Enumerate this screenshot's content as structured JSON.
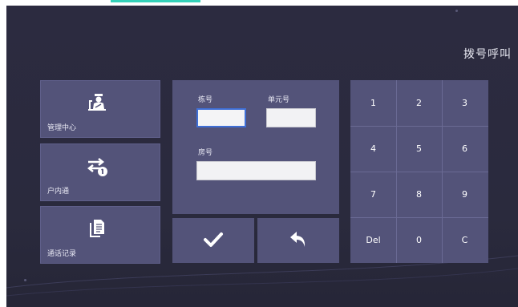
{
  "title": "拨号呼叫",
  "menu": [
    {
      "label": "管理中心",
      "icon": "guard-icon"
    },
    {
      "label": "户内通",
      "icon": "intercom-icon"
    },
    {
      "label": "通话记录",
      "icon": "records-icon"
    }
  ],
  "form": {
    "building_label": "栋号",
    "building_value": "",
    "unit_label": "单元号",
    "unit_value": "",
    "room_label": "房号",
    "room_value": ""
  },
  "actions": {
    "confirm_icon": "check-icon",
    "back_icon": "back-arrow-icon"
  },
  "keypad": [
    "1",
    "2",
    "3",
    "4",
    "5",
    "6",
    "7",
    "8",
    "9",
    "Del",
    "0",
    "C"
  ],
  "colors": {
    "background": "#2c2b40",
    "tile": "#535379",
    "accent": "#34d1b9",
    "focus_border": "#3f6fd6"
  }
}
